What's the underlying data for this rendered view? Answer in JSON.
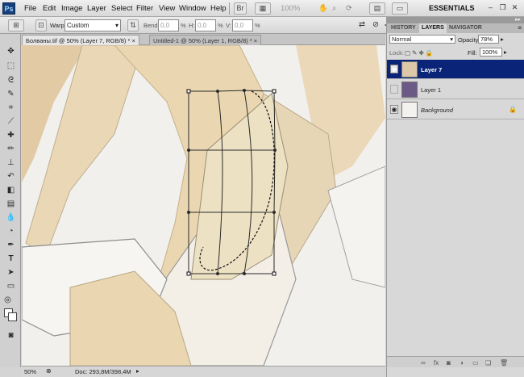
{
  "app": {
    "logo": "Ps"
  },
  "menu": [
    "File",
    "Edit",
    "Image",
    "Layer",
    "Select",
    "Filter",
    "View",
    "Window",
    "Help"
  ],
  "menubar_extra": {
    "zoom": "100%",
    "workspace": "ESSENTIALS"
  },
  "options": {
    "warp_label": "Warp:",
    "warp_style": "Custom",
    "bend_label": "Bend:",
    "bend_value": "0,0",
    "h_label": "H:",
    "h_value": "0,0",
    "v_label": "V:",
    "v_value": "0,0",
    "unit": "%"
  },
  "tabs": [
    {
      "label": "Болваны.tif @ 50% (Layer 7, RGB/8) *"
    },
    {
      "label": "Untitled-1 @ 50% (Layer 1, RGB/8) *"
    }
  ],
  "status": {
    "zoom": "50%",
    "doc": "Doc: 293,8M/398,4M"
  },
  "panel": {
    "tabs": [
      "HISTORY",
      "LAYERS",
      "NAVIGATOR"
    ],
    "blend_mode": "Normal",
    "opacity_label": "Opacity:",
    "opacity_value": "78%",
    "lock_label": "Lock:",
    "fill_label": "Fill:",
    "fill_value": "100%",
    "layers": [
      {
        "name": "Layer 7",
        "selected": true,
        "visible": true
      },
      {
        "name": "Layer 1",
        "selected": false,
        "visible": false
      },
      {
        "name": "Background",
        "selected": false,
        "visible": true,
        "locked": true
      }
    ]
  },
  "colors": {
    "selected_layer": "#0a2478",
    "layer1_thumb": "#6b5a86"
  }
}
